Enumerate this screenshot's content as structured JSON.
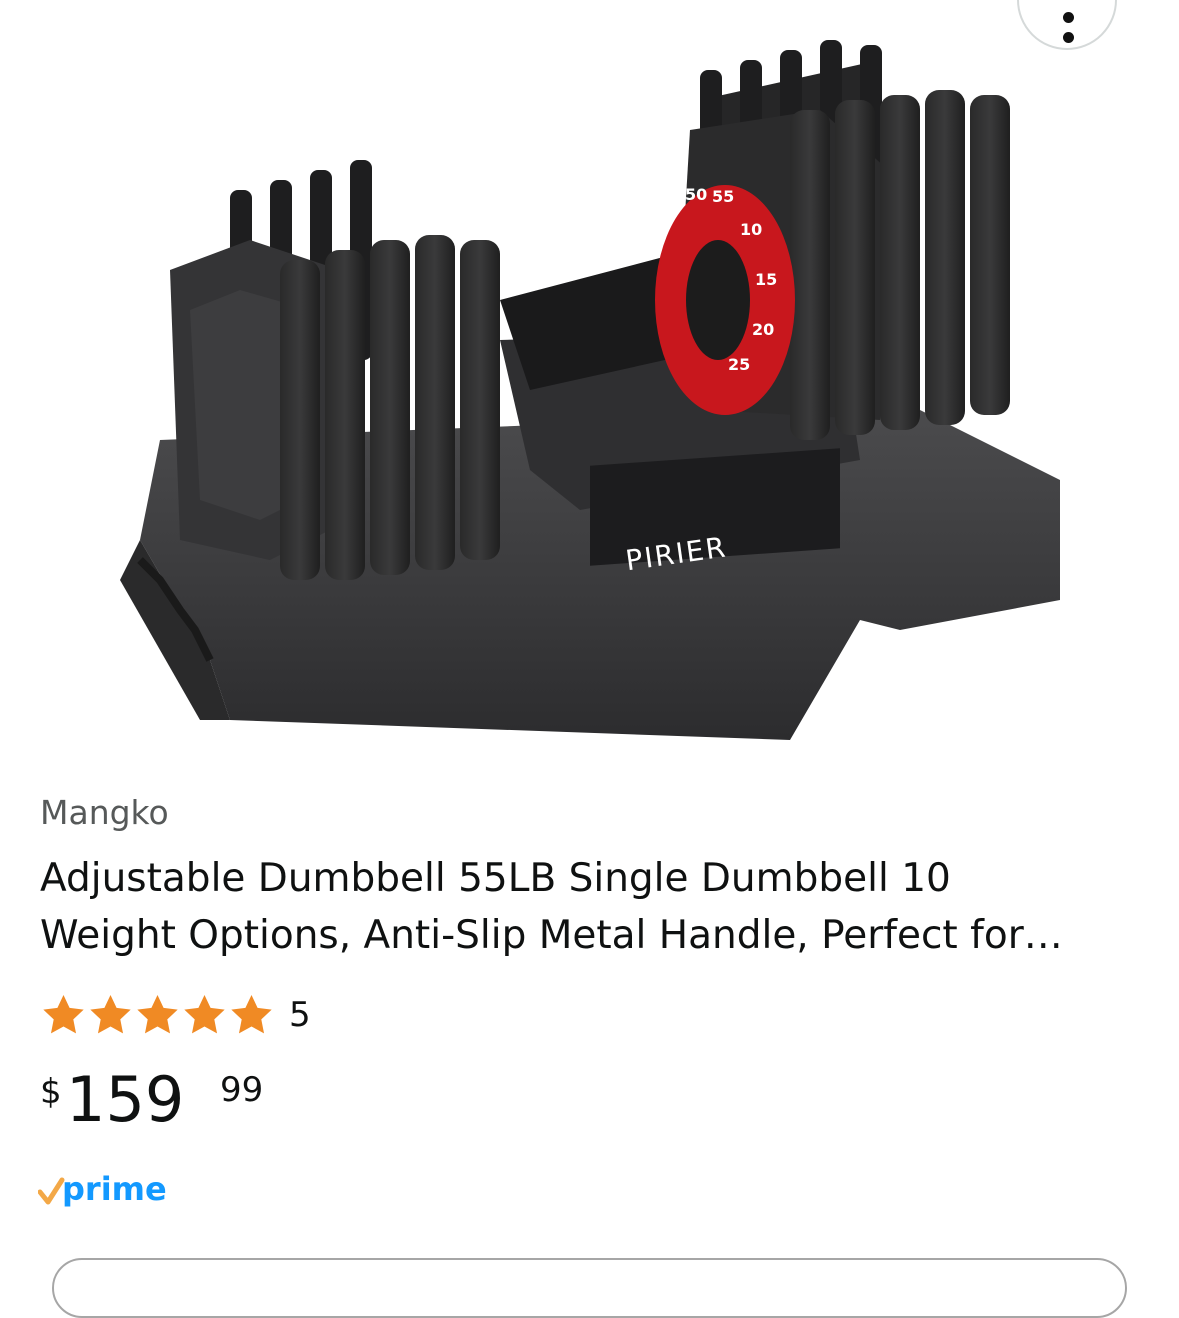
{
  "product": {
    "brand": "Mangko",
    "title": "Adjustable Dumbbell 55LB Single Dumbbell 10\nWeight Options, Anti-Slip Metal Handle, Perfect for…",
    "rating": {
      "value": 5,
      "max": 5,
      "count_label": "5"
    },
    "price": {
      "currency_symbol": "$",
      "whole": "159",
      "fraction": "99"
    },
    "prime_label": "prime",
    "image": {
      "logo_text": "PIRIER",
      "dial_numbers": [
        "50",
        "55",
        "10",
        "15",
        "20",
        "25"
      ]
    }
  },
  "icons": {
    "more": "more-vertical-icon",
    "star": "star-icon",
    "prime_check": "prime-check-icon"
  },
  "colors": {
    "star": "#f08a24",
    "prime_blue": "#1399ff",
    "prime_check": "#f3a847",
    "dial_red": "#c8171d",
    "brand_text": "#565959"
  }
}
